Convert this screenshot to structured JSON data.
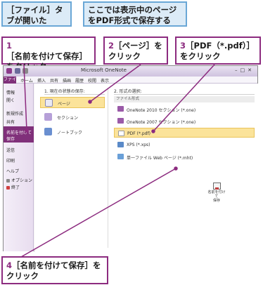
{
  "callouts": {
    "note1": "［ファイル］タブが開いた",
    "note2_line1": "ここでは表示中のページ",
    "note2_line2": "をPDF形式で保存する",
    "step1_num": "1",
    "step1_line1": "［名前を付けて保存］",
    "step1_line2": "をクリック",
    "step2_num": "2",
    "step2_line1": "［ページ］を",
    "step2_line2": "クリック",
    "step3_num": "3",
    "step3_line1": "［PDF（*.pdf）］",
    "step3_line2": "をクリック",
    "step4_num": "4",
    "step4_line1": "［名前を付けて保存］を",
    "step4_line2": "クリック"
  },
  "window": {
    "title": "Microsoft OneNote",
    "file_tab": "ファイル",
    "tabs": [
      "ホーム",
      "挿入",
      "共有",
      "描画",
      "履歴",
      "校閲",
      "表示"
    ]
  },
  "sidebar": {
    "items": [
      "情報",
      "開く",
      "新規作成",
      "共有",
      "名前を付けて保存",
      "送信",
      "印刷",
      "ヘルプ",
      "オプション",
      "終了"
    ]
  },
  "main": {
    "section1_header": "1. 現在の状態の保存:",
    "scopes": [
      "ページ",
      "セクション",
      "ノートブック"
    ],
    "section2_header": "2. 形式の選択:",
    "formats_header": "ファイル形式",
    "formats": [
      "OneNote 2010 セクション (*.one)",
      "OneNote 2007 セクション (*.one)",
      "PDF (*.pdf)",
      "XPS (*.xps)",
      "単一ファイル Web ページ (*.mht)"
    ],
    "save_label_line1": "名前を付けて",
    "save_label_line2": "保存"
  },
  "colors": {
    "accent": "#8c2b7f",
    "note_border": "#6aa7d6",
    "note_fill": "#dcebf7",
    "selection": "#fbe39a"
  }
}
